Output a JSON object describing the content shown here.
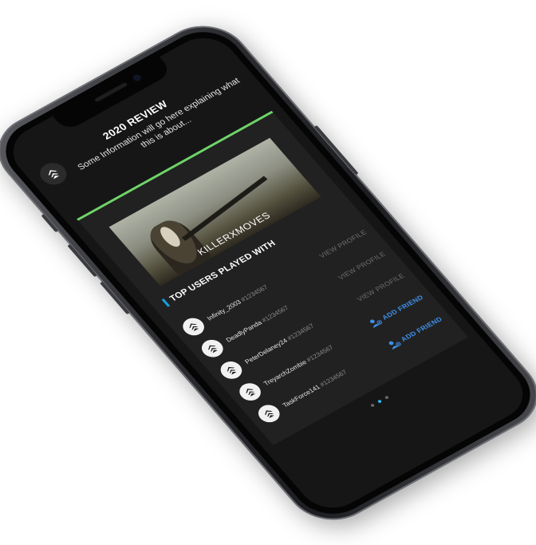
{
  "header": {
    "title": "2020 REVIEW",
    "subtitle": "Some Information will go here explaining what this is about..."
  },
  "card": {
    "player_name": "KILLERXMOVES",
    "section_title": "TOP USERS PLAYED WITH"
  },
  "users": [
    {
      "name": "Infinity_2003",
      "tag": "#1234567",
      "action": "VIEW PROFILE",
      "action_type": "view"
    },
    {
      "name": "DeadlyPanda",
      "tag": "#1234567",
      "action": "VIEW PROFILE",
      "action_type": "view"
    },
    {
      "name": "PeterDelaney24",
      "tag": "#1234567",
      "action": "VIEW PROFILE",
      "action_type": "view"
    },
    {
      "name": "TreyarchZombie",
      "tag": "#1234567",
      "action": "ADD FRIEND",
      "action_type": "add"
    },
    {
      "name": "TaskForce141",
      "tag": "#1234567",
      "action": "ADD FRIEND",
      "action_type": "add"
    }
  ],
  "pagination": {
    "count": 3,
    "active": 1
  },
  "colors": {
    "accent_green": "#6fd46a",
    "accent_blue": "#18a0e0",
    "add_friend": "#3f8fe8"
  }
}
